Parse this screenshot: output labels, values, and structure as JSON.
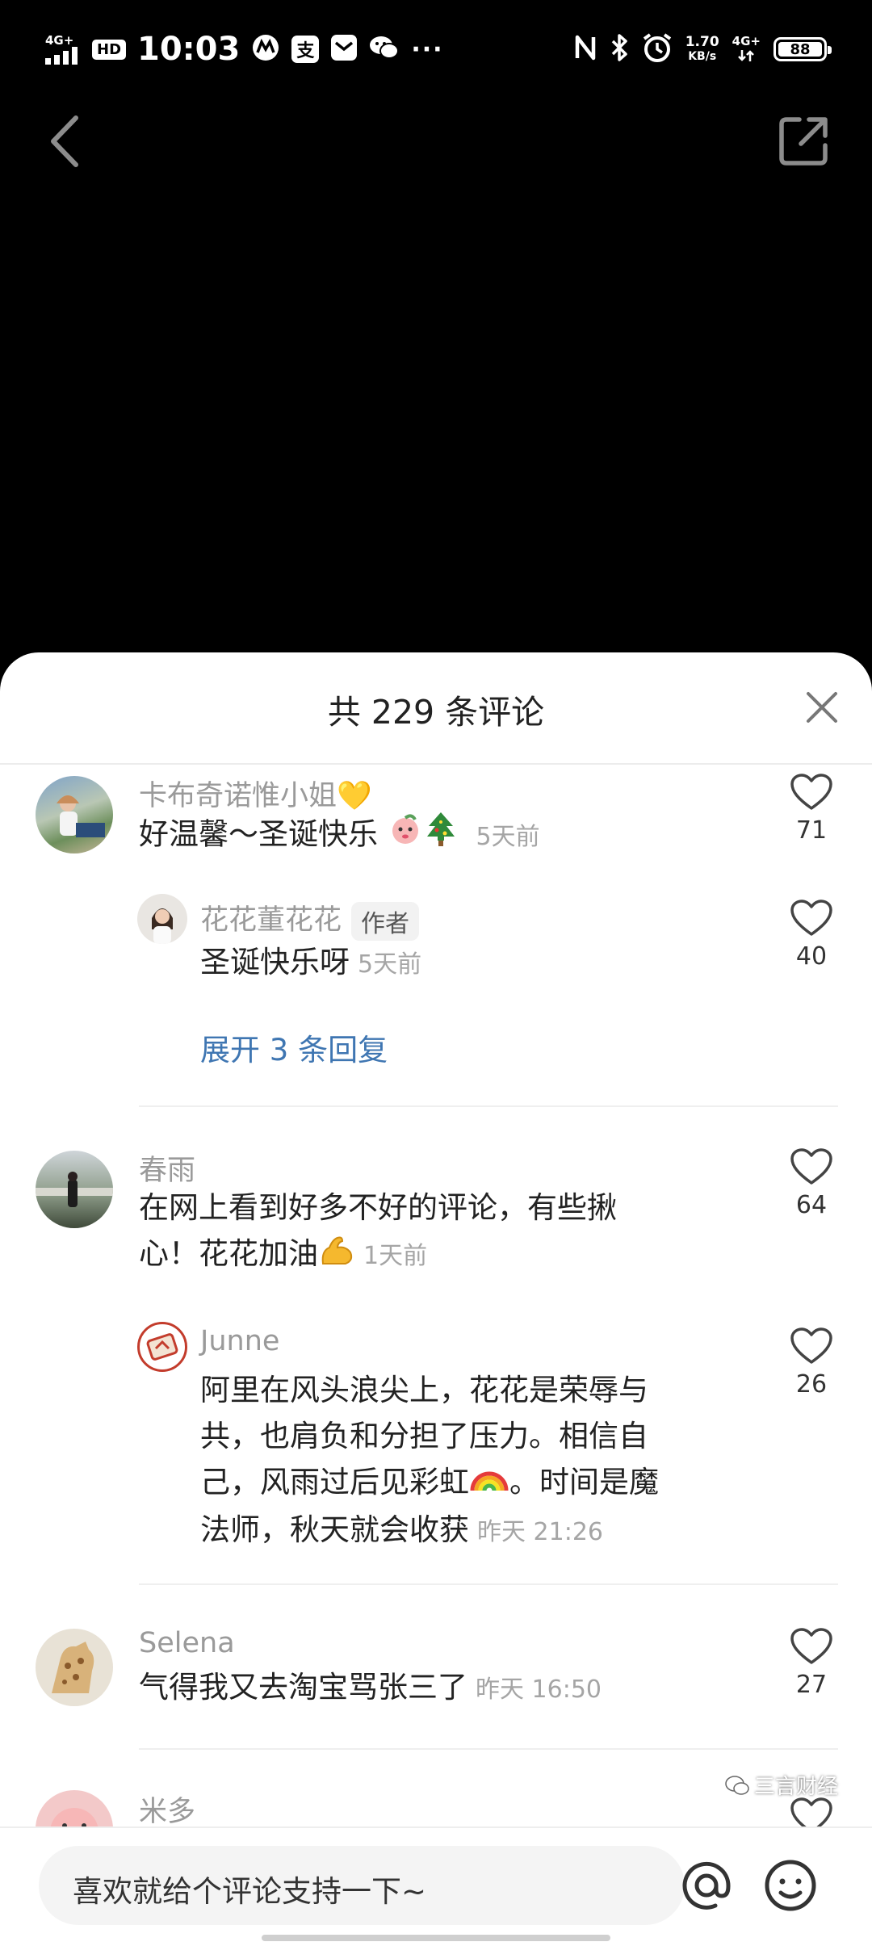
{
  "status_bar": {
    "network_left": "4G+",
    "hd": "HD",
    "time": "10:03",
    "speed_value": "1.70",
    "speed_unit": "KB/s",
    "network_right": "4G+",
    "battery": "88"
  },
  "sheet": {
    "title": "共 229 条评论"
  },
  "comments": [
    {
      "name": "卡布奇诺惟小姐💛",
      "text": "好温馨～圣诞快乐",
      "time": "5天前",
      "likes": "71",
      "replies": [
        {
          "name": "花花董花花",
          "badge": "作者",
          "text": "圣诞快乐呀",
          "time": "5天前",
          "likes": "40"
        }
      ],
      "expand": "展开 3 条回复"
    },
    {
      "name": "春雨",
      "text_line1": "在网上看到好多不好的评论，有些揪",
      "text_line2": "心！花花加油",
      "time": "1天前",
      "likes": "64",
      "replies": [
        {
          "name": "Junne",
          "line1": "阿里在风头浪尖上，花花是荣辱与",
          "line2": "共，也肩负和分担了压力。相信自",
          "line3": "己，风雨过后见彩虹",
          "line3b": "。时间是魔",
          "line4": "法师，秋天就会收获",
          "time": "昨天 21:26",
          "likes": "26"
        }
      ]
    },
    {
      "name": "Selena",
      "text": "气得我又去淘宝骂张三了",
      "time": "昨天 16:50",
      "likes": "27"
    },
    {
      "name": "米多"
    }
  ],
  "input": {
    "placeholder": "喜欢就给个评论支持一下~"
  },
  "watermark": "三言财经",
  "colors": {
    "link": "#3f76b2",
    "muted": "#9a9a9a",
    "sheet_bg": "#ffffff",
    "top_bg": "#000000"
  }
}
